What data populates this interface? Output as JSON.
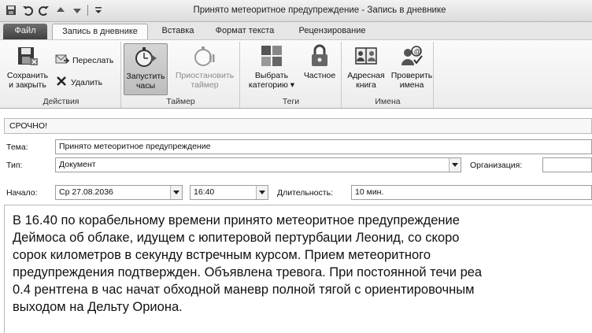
{
  "window": {
    "title": "Принято метеоритное предупреждение  -  Запись в дневнике"
  },
  "quick_access": [
    "save-icon",
    "undo-icon",
    "redo-icon",
    "up-arrow-icon",
    "down-arrow-icon",
    "customize-icon"
  ],
  "tabs": [
    {
      "label": "Файл"
    },
    {
      "label": "Запись в дневнике"
    },
    {
      "label": "Вставка"
    },
    {
      "label": "Формат текста"
    },
    {
      "label": "Рецензирование"
    }
  ],
  "ribbon": {
    "groups": {
      "actions": "Действия",
      "timer": "Таймер",
      "tags": "Теги",
      "names": "Имена"
    },
    "save_close": [
      "Сохранить",
      "и закрыть"
    ],
    "forward": "Переслать",
    "delete": "Удалить",
    "start_timer": [
      "Запустить",
      "часы"
    ],
    "pause_timer": [
      "Приостановить",
      "таймер"
    ],
    "categorize": [
      "Выбрать",
      "категорию ▾"
    ],
    "private": "Частное",
    "address_book": [
      "Адресная",
      "книга"
    ],
    "check_names": [
      "Проверить",
      "имена"
    ]
  },
  "form": {
    "infobar": "СРОЧНО!",
    "subject_label": "Тема:",
    "subject_value": "Принято метеоритное предупреждение",
    "type_label": "Тип:",
    "type_value": "Документ",
    "company_label": "Организация:",
    "company_value": "",
    "start_label": "Начало:",
    "start_date": "Ср 27.08.2036",
    "start_time": "16:40",
    "duration_label": "Длительность:",
    "duration_value": "10 мин."
  },
  "body_lines": [
    "В 16.40 по корабельному времени принято метеоритное предупреждение",
    "Деймоса об облаке, идущем с юпитеровой пертурбации Леонид, со скоро",
    "сорок километров в секунду встречным курсом. Прием метеоритного",
    "предупреждения подтвержден. Объявлена тревога. При постоянной течи реа",
    "0.4 рентгена в час начат обходной маневр полной тягой с ориентировочным",
    "выходом на Дельту Ориона."
  ]
}
